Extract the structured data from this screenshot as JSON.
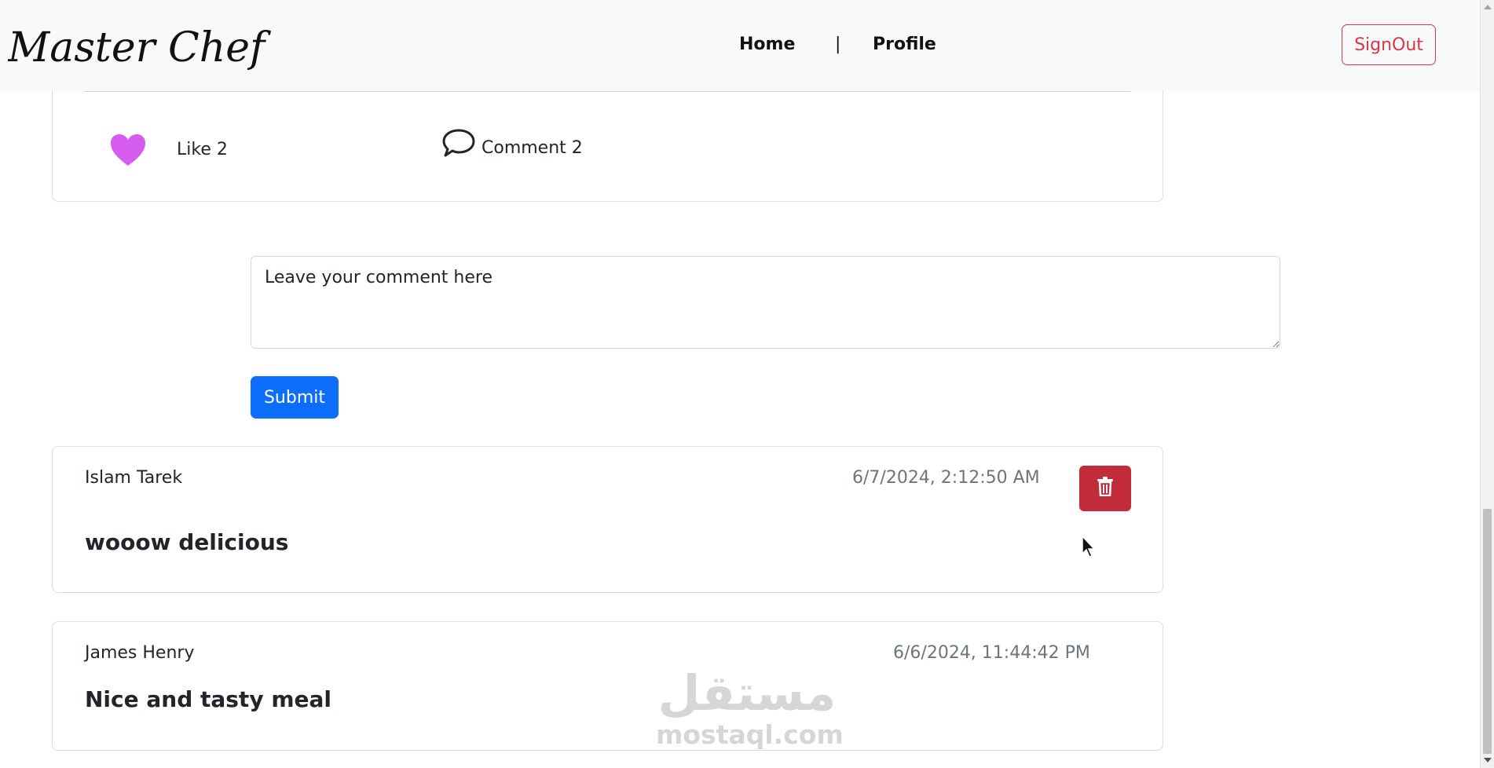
{
  "navbar": {
    "brand": "Master Chef",
    "links": [
      "Home",
      "|",
      "Profile"
    ],
    "signout_label": "SignOut",
    "signout_color": "#dc3545"
  },
  "post": {
    "like_label": "Like 2",
    "like_icon": "heart-icon",
    "like_color": "#d65cf0",
    "comment_label": "Comment 2",
    "comment_icon": "speech-bubble-icon"
  },
  "comment_form": {
    "placeholder": "Leave your comment here",
    "submit_label": "Submit",
    "submit_color": "#0d6efd"
  },
  "comments": [
    {
      "author": "Islam Tarek",
      "time": "6/7/2024, 2:12:50 AM",
      "text": "wooow delicious",
      "delete_icon": "trash-icon"
    },
    {
      "author": "James Henry",
      "time": "6/6/2024, 11:44:42 PM",
      "text": "Nice and tasty meal"
    }
  ],
  "watermark": {
    "arabic": "مستقل",
    "latin": "mostaql.com"
  }
}
